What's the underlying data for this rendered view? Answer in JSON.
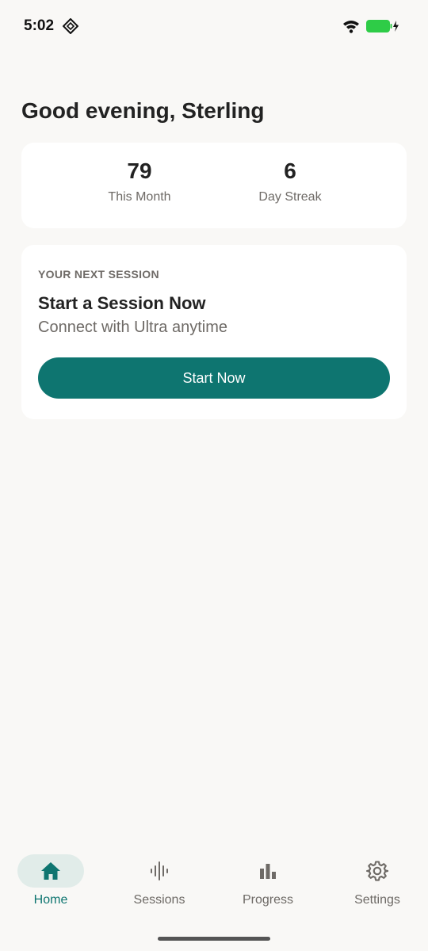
{
  "status_bar": {
    "time": "5:02"
  },
  "greeting": "Good evening, Sterling",
  "stats": {
    "month_value": "79",
    "month_label": "This Month",
    "streak_value": "6",
    "streak_label": "Day Streak"
  },
  "next_session": {
    "eyebrow": "YOUR NEXT SESSION",
    "title": "Start a Session Now",
    "subtitle": "Connect with Ultra anytime",
    "button_label": "Start Now"
  },
  "nav": {
    "items": [
      {
        "label": "Home",
        "icon": "home-icon",
        "active": true
      },
      {
        "label": "Sessions",
        "icon": "waveform-icon",
        "active": false
      },
      {
        "label": "Progress",
        "icon": "bar-chart-icon",
        "active": false
      },
      {
        "label": "Settings",
        "icon": "gear-icon",
        "active": false
      }
    ]
  },
  "colors": {
    "accent": "#0e7570",
    "background": "#f9f8f6",
    "card": "#ffffff",
    "muted_text": "#6e6a66",
    "active_pill": "#e1ece9",
    "battery": "#2ecc47"
  }
}
